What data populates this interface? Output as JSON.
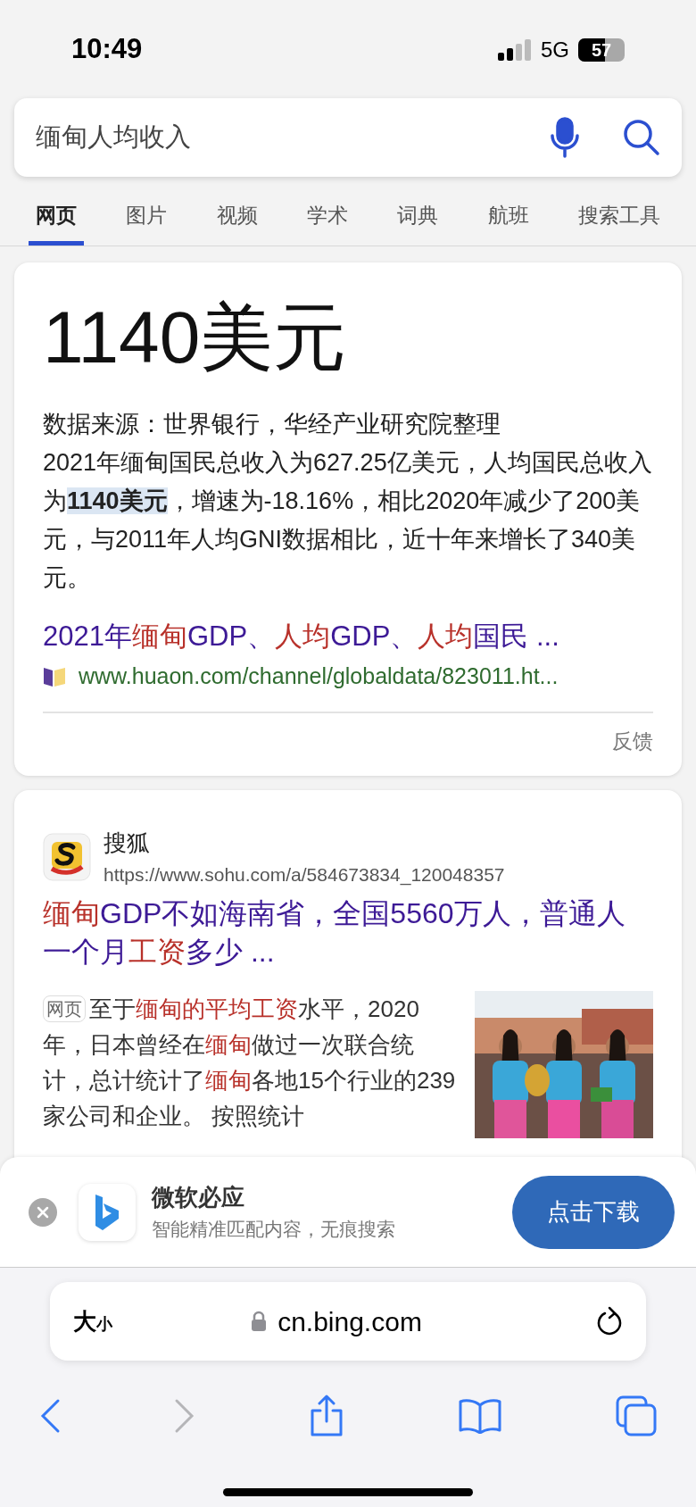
{
  "status_bar": {
    "time": "10:49",
    "network": "5G",
    "battery": "57"
  },
  "search": {
    "value": "缅甸人均收入"
  },
  "tabs": [
    {
      "label": "网页",
      "selected": true
    },
    {
      "label": "图片",
      "selected": false
    },
    {
      "label": "视频",
      "selected": false
    },
    {
      "label": "学术",
      "selected": false
    },
    {
      "label": "词典",
      "selected": false
    },
    {
      "label": "航班",
      "selected": false
    },
    {
      "label": "搜索工具",
      "selected": false
    }
  ],
  "answer_card": {
    "headline": "1140美元",
    "paragraph": [
      {
        "text": "数据来源：世界银行，华经产业研究院整理\n2021年缅甸国民总收入为627.25亿美元，人均国民总收入为",
        "highlight": false
      },
      {
        "text": "1140美元",
        "highlight": true
      },
      {
        "text": "，增速为-18.16%，相比2020年减少了200美元，与2011年人均GNI数据相比，近十年来增长了340美元。",
        "highlight": false
      }
    ],
    "link_title": [
      {
        "text": "2021年",
        "highlight": false
      },
      {
        "text": "缅甸",
        "highlight": true
      },
      {
        "text": "GDP、",
        "highlight": false
      },
      {
        "text": "人均",
        "highlight": true
      },
      {
        "text": "GDP、",
        "highlight": false
      },
      {
        "text": "人均",
        "highlight": true
      },
      {
        "text": "国民 ...",
        "highlight": false
      }
    ],
    "url": "www.huaon.com/channel/globaldata/823011.ht...",
    "feedback": "反馈"
  },
  "result": {
    "site": "搜狐",
    "url": "https://www.sohu.com/a/584673834_120048357",
    "title": [
      {
        "text": "缅甸",
        "highlight": true
      },
      {
        "text": "GDP不如海南省，全国5560万人，普通人一个月",
        "highlight": false
      },
      {
        "text": "工资",
        "highlight": true
      },
      {
        "text": "多少 ...",
        "highlight": false
      }
    ],
    "tag": "网页",
    "snippet": [
      {
        "text": "至于",
        "highlight": false
      },
      {
        "text": "缅甸的平均工资",
        "highlight": true
      },
      {
        "text": "水平，2020年，日本曾经在",
        "highlight": false
      },
      {
        "text": "缅甸",
        "highlight": true
      },
      {
        "text": "做过一次联合统计，总计统计了",
        "highlight": false
      },
      {
        "text": "缅甸",
        "highlight": true
      },
      {
        "text": "各地15个行业的239家公司和企业。 按照统计",
        "highlight": false
      }
    ]
  },
  "app_banner": {
    "name": "微软必应",
    "tagline": "智能精准匹配内容，无痕搜索",
    "button": "点击下载"
  },
  "browser": {
    "text_size": {
      "large": "大",
      "small": "小"
    },
    "domain": "cn.bing.com",
    "forward_disabled": true
  }
}
